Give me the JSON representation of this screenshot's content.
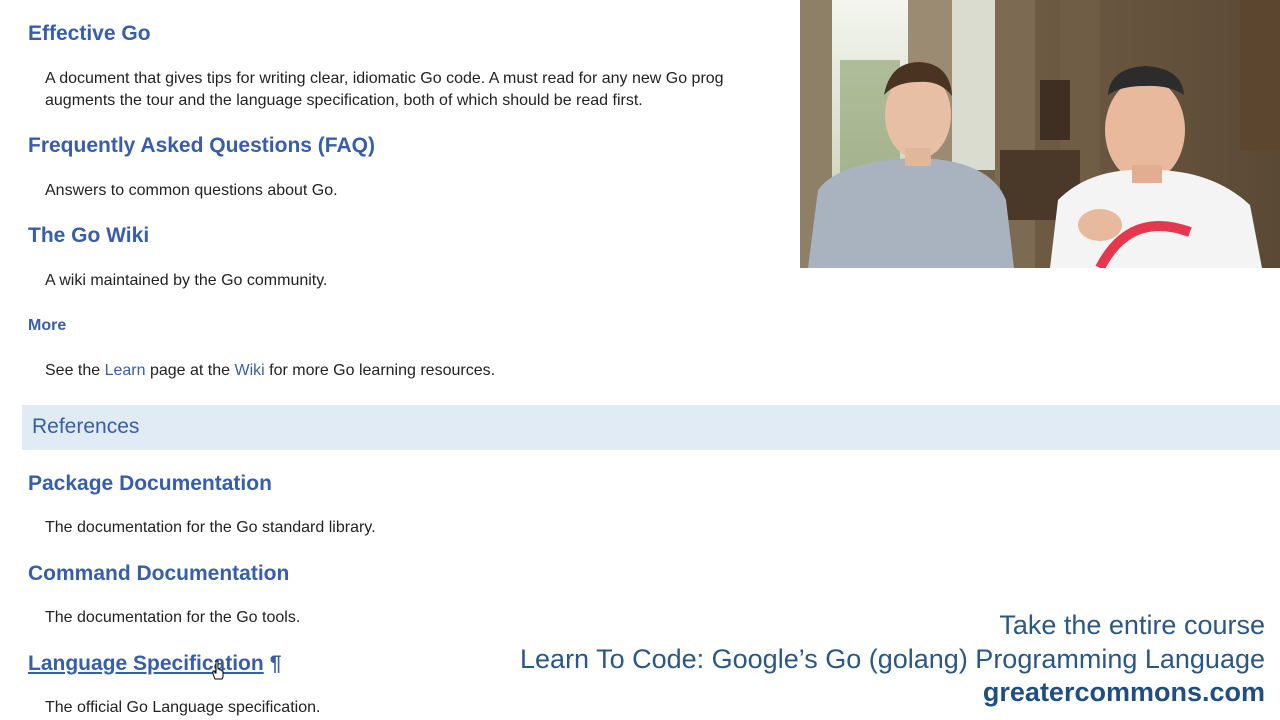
{
  "resources": [
    {
      "title": "Effective Go",
      "desc_line1": "A document that gives tips for writing clear, idiomatic Go code. A must read for any new Go prog",
      "desc_line2": "augments the tour and the language specification, both of which should be read first."
    },
    {
      "title": "Frequently Asked Questions (FAQ)",
      "desc": "Answers to common questions about Go."
    },
    {
      "title": "The Go Wiki",
      "desc": "A wiki maintained by the Go community."
    }
  ],
  "more": {
    "title": "More",
    "desc_before": "See the ",
    "learn_link": "Learn",
    "desc_middle": " page at the ",
    "wiki_link": "Wiki",
    "desc_after": " for more Go learning resources."
  },
  "references_section": {
    "title": "References"
  },
  "references": [
    {
      "title": "Package Documentation",
      "desc": "The documentation for the Go standard library."
    },
    {
      "title": "Command Documentation",
      "desc": "The documentation for the Go tools."
    },
    {
      "title": "Language Specification",
      "pilcrow": "¶",
      "desc": "The official Go Language specification."
    }
  ],
  "promo": {
    "line1": "Take the entire course",
    "line2": "Learn To Code: Google’s Go (golang) Programming Language",
    "line3": "greatercommons.com"
  },
  "colors": {
    "link": "#375eab",
    "section_bg": "#e0ebf5",
    "promo": "#2a5886"
  }
}
